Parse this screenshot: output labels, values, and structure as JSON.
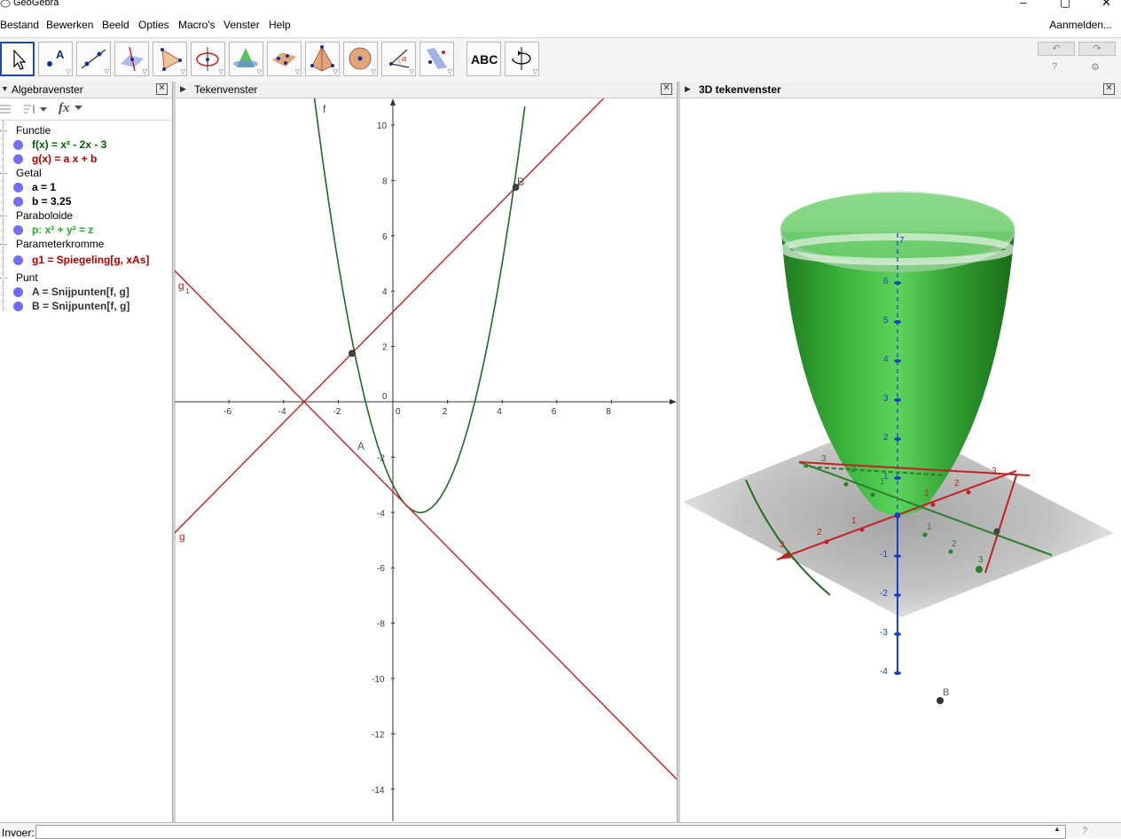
{
  "window": {
    "title": "GeoGebra"
  },
  "menu": [
    "Bestand",
    "Bewerken",
    "Beeld",
    "Opties",
    "Macro's",
    "Venster",
    "Help"
  ],
  "login": "Aanmelden...",
  "toolbar": {
    "tools": [
      "move-tool",
      "point-tool",
      "line-tool",
      "perpendicular-line-tool",
      "polygon-tool",
      "circle-axis-tool",
      "intersect-surfaces-tool",
      "plane-tool",
      "pyramid-tool",
      "sphere-tool",
      "angle-tool",
      "reflect-plane-tool",
      "text-tool",
      "rotate-view-tool"
    ],
    "text_tool_label": "ABC",
    "help_icon": "?",
    "settings_icon": "⚙"
  },
  "algebra": {
    "title": "Algebravenster",
    "fx": "fx",
    "categories": [
      {
        "label": "Functie",
        "items": [
          {
            "text": "f(x) = x² - 2x - 3",
            "color": "#006400"
          },
          {
            "text": "g(x) = a x + b",
            "color": "#b00000"
          }
        ]
      },
      {
        "label": "Getal",
        "items": [
          {
            "text": "a = 1",
            "color": "#000000"
          },
          {
            "text": "b = 3.25",
            "color": "#000000"
          }
        ]
      },
      {
        "label": "Paraboloide",
        "items": [
          {
            "text": "p: x² + y² = z",
            "color": "#22aa22"
          }
        ]
      },
      {
        "label": "Parameterkromme",
        "items": [
          {
            "text": "g1 = Spiegeling[g, xAs]",
            "color": "#b00000"
          }
        ]
      },
      {
        "label": "Punt",
        "items": [
          {
            "text": "A = Snijpunten[f, g]",
            "color": "#333333"
          },
          {
            "text": "B = Snijpunten[f, g]",
            "color": "#333333"
          }
        ]
      }
    ]
  },
  "graphics2d": {
    "title": "Tekenvenster",
    "x_ticks": [
      "-6",
      "-4",
      "-2",
      "0",
      "2",
      "4",
      "6",
      "8"
    ],
    "y_ticks": [
      "10",
      "8",
      "6",
      "4",
      "2",
      "0",
      "-2",
      "-4",
      "-6",
      "-8",
      "-10",
      "-12",
      "-14"
    ],
    "labels": {
      "f": "f",
      "g": "g",
      "g1": "g",
      "g1_sub": "1",
      "A": "A",
      "B": "B"
    },
    "points": {
      "A": [
        -1.5,
        1.75
      ],
      "B": [
        4.5,
        7.75
      ]
    }
  },
  "graphics3d": {
    "title": "3D tekenvenster",
    "z_ticks": [
      "7",
      "6",
      "5",
      "4",
      "3",
      "2",
      "1",
      "-1",
      "-2",
      "-3",
      "-4"
    ],
    "red_ticks": [
      "3",
      "2",
      "1",
      "1",
      "2",
      "3"
    ],
    "green_ticks": [
      "3",
      "2",
      "1",
      "1",
      "2",
      "3"
    ],
    "point_label": "B"
  },
  "input": {
    "label": "Invoer:",
    "value": "",
    "help": "?"
  },
  "colors": {
    "f": "#1e6b1e",
    "g": "#c22222",
    "accent": "#2148a8",
    "axis3d": "#1a3fd0"
  }
}
